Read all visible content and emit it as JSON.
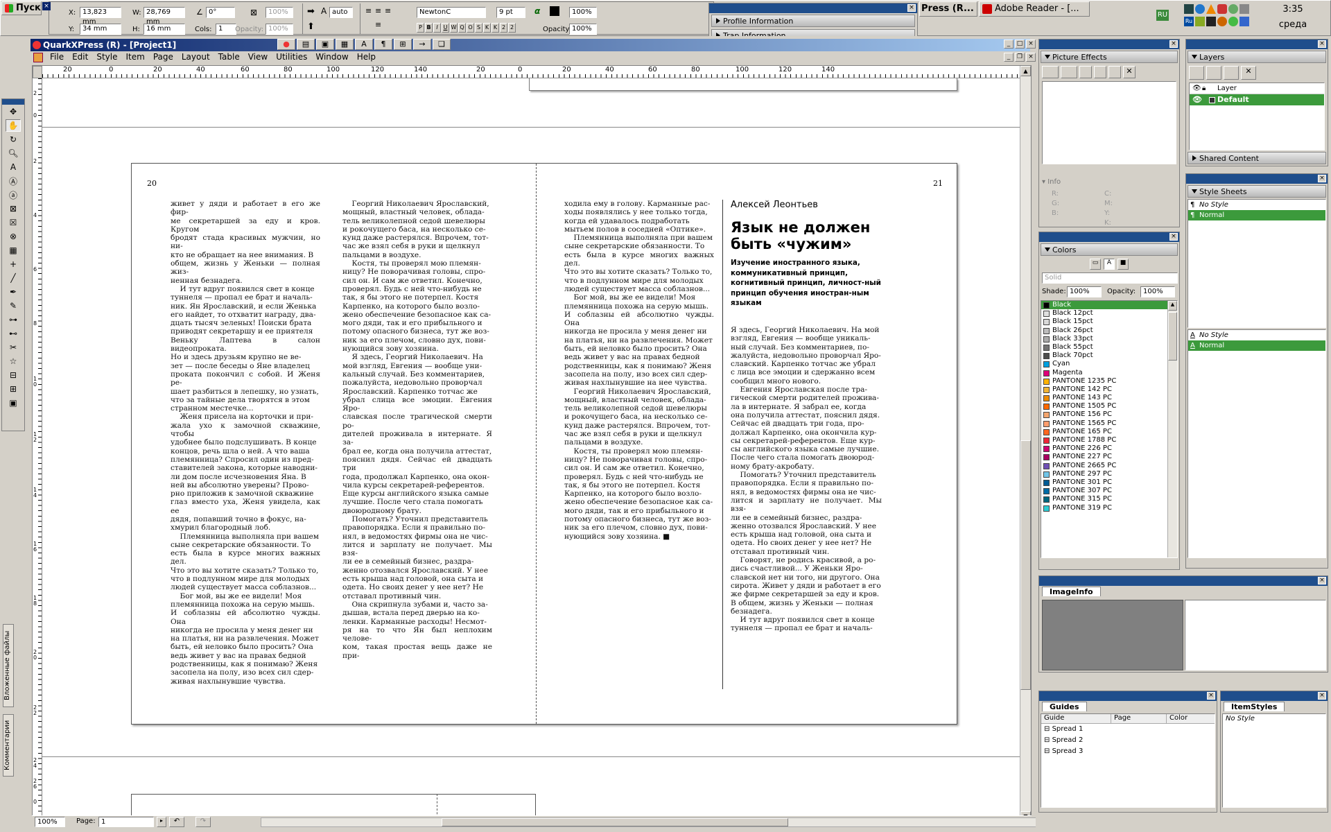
{
  "taskbar": {
    "start_label": "Пуск",
    "tasks": [
      {
        "label": "Press (R..."
      },
      {
        "label": "Adobe Reader - [..."
      }
    ],
    "lang": "RU",
    "time": "3:35",
    "day": "среда"
  },
  "measure": {
    "x_label": "X:",
    "x_value": "13,823 mm",
    "w_label": "W:",
    "w_value": "28,769 mm",
    "y_label": "Y:",
    "y_value": "34 mm",
    "h_label": "H:",
    "h_value": "16 mm",
    "angle": "0°",
    "cols_label": "Cols:",
    "cols_value": "1",
    "opacity_label": "Opacity:",
    "opacity_value": "100%",
    "opacity2_value": "100%",
    "leading": "auto",
    "font": "NewtonC",
    "size": "9 pt",
    "shade": "100%",
    "opacity3_label": "Opacity:",
    "opacity3_value": "100%",
    "style_buttons": [
      "P",
      "B",
      "I",
      "U",
      "W",
      "Q",
      "O",
      "S",
      "K",
      "K",
      "2",
      "2"
    ]
  },
  "floating_palette": {
    "items": [
      {
        "label": "Profile Information"
      },
      {
        "label": "Trap Information"
      }
    ]
  },
  "app": {
    "title": "QuarkXPress (R) - [Project1]",
    "menu": [
      "File",
      "Edit",
      "Style",
      "Item",
      "Page",
      "Layout",
      "Table",
      "View",
      "Utilities",
      "Window",
      "Help"
    ]
  },
  "rulers": {
    "h_labels": [
      "20",
      "0",
      "20",
      "40",
      "60",
      "80",
      "100",
      "120",
      "140",
      "20",
      "0",
      "20",
      "40",
      "60",
      "80",
      "100",
      "120",
      "140"
    ],
    "v_labels": [
      "2",
      "0",
      "2",
      "4",
      "6",
      "8",
      "1 0",
      "1 2",
      "1 4",
      "1 6",
      "1 8",
      "2 0",
      "2 2",
      "2 4",
      "2 6",
      "0"
    ]
  },
  "page_left": {
    "number": "20",
    "col1": "живет у дяди и работает в его же фир-\nме секретаршей за еду и кров. Кругом\nбродят стада красивых мужчин, но ни-\nкто не обращает на нее внимания. В\nобщем, жизнь у Женьки — полная жиз-\nненная безнадега.\n    И тут вдруг появился свет в конце\nтуннеля — пропал ее брат и началь-\nник. Ян Ярославский, и если Женька\nего найдет, то отхватит награду, два-\nдцать тысяч зеленых! Поиски брата\nприводят секретаршу и ее приятеля\nВеньку Лаптева в салон видеопроката.\nНо и здесь друзьям крупно не ве-\nзет — после беседы о Яне владелец\nпроката покончил с собой. И Женя ре-\nшает разбиться в лепешку, но узнать,\nчто за тайные дела творятся в этом\nстранном местечке...\n    Женя присела на корточки и при-\nжала ухо к замочной скважине, чтобы\nудобнее было подслушивать. В конце\nконцов, речь шла о ней. А что ваша\nплемянница? Спросил один из пред-\nставителей закона, которые наводни-\nли дом после исчезновения Яна. В\nней вы абсолютно уверены? Прово-\nрно приложив к замочной скважине\nглаз вместо уха, Женя увидела, как ее\nдядя, попавший точно в фокус, на-\nхмурил благородный лоб.\n    Племянница выполняла при вашем\nсыне секретарские обязанности. То\nесть была в курсе многих важных дел.\nЧто это вы хотите сказать? Только то,\nчто в подлунном мире для молодых\nлюдей существует масса соблазнов...\n    Бог мой, вы же ее видели! Моя\nплемянница похожа на серую мышь.\nИ соблазны ей абсолютно чужды. Она\nникогда не просила у меня денег ни\nна платья, ни на развлечения. Может\nбыть, ей неловко было просить? Она\nведь живет у вас на правах бедной\nродственницы, как я понимаю? Женя\nзасопела на полу, изо всех сил сдер-\nживая нахлынувшие чувства.",
    "col2": "    Георгий Николаевич Ярославский,\nмощный, властный человек, облада-\nтель великолепной седой шевелюры\nи рокочущего баса, на несколько се-\nкунд даже растерялся. Впрочем, тот-\nчас же взял себя в руки и щелкнул\nпальцами в воздухе.\n    Костя, ты проверял мою племян-\nницу? Не поворачивая головы, спро-\nсил он. И сам же ответил. Конечно,\nпроверял. Будь с ней что-нибудь не\nтак, я бы этого не потерпел. Костя\nКарпенко, на которого было возло-\nжено обеспечение безопасное как са-\nмого дяди, так и его прибыльного и\nпотому опасного бизнеса, тут же воз-\nник за его плечом, словно дух, пови-\nнующийся зову хозяина.\n    Я здесь, Георгий Николаевич. На\nмой взгляд, Евгения — вообще уни-\nкальный случай. Без комментариев,\nпожалуйста, недовольно проворчал\nЯрославский. Карпенко тотчас же\nубрал слица все эмоции. Евгения Яро-\nславская после трагической смерти ро-\nдителей проживала в интернате. Я за-\nбрал ее, когда она получила аттестат,\nпояснил дядя. Сейчас ей двадцать три\nгода, продолжал Карпенко, она окон-\nчила курсы секретарей-референтов.\nЕще курсы английского языка самые\nлучшие. После чего стала помогать\nдвоюродному брату.\n    Помогать? Уточнил представитель\nправопорядка. Если я правильно по-\nнял, в ведомостях фирмы она не чис-\nлится и зарплату не получает. Мы взя-\nли ее в семейный бизнес, раздра-\nженно отозвался Ярославский. У нее\nесть крыша над головой, она сыта и\nодета. Но своих денег у нее нет? Не\nотставал противный чин.\n    Она скрипнула зубами и, часто за-\nдышав, встала перед дверью на ко-\nленки. Карманные расходы! Несмот-\nря на то что Ян был неплохим челове-\nком, такая простая вещь даже не при-"
  },
  "page_right": {
    "number": "21",
    "col1": "ходила ему в голову. Карманные рас-\nходы появлялись у нее только тогда,\nкогда ей удавалось подработать\nмытьем полов в соседней «Оптике».\n    Племянница выполняла при вашем\nсыне секретарские обязанности. То\nесть была в курсе многих важных дел.\nЧто это вы хотите сказать? Только то,\nчто в подлунном мире для молодых\nлюдей существует масса соблазнов...\n    Бог мой, вы же ее видели! Моя\nплемянница похожа на серую мышь.\nИ соблазны ей абсолютно чужды. Она\nникогда не просила у меня денег ни\nна платья, ни на развлечения. Может\nбыть, ей неловко было просить? Она\nведь живет у вас на правах бедной\nродственницы, как я понимаю? Женя\nзасопела на полу, изо всех сил сдер-\nживая нахлынувшие на нее чувства.\n    Георгий Николаевич Ярославский,\nмощный, властный человек, облада-\nтель великолепной седой шевелюры\nи рокочущего баса, на несколько се-\nкунд даже растерялся. Впрочем, тот-\nчас же взял себя в руки и щелкнул\nпальцами в воздухе.\n    Костя, ты проверял мою племян-\nницу? Не поворачивая головы, спро-\nсил он. И сам же ответил. Конечно,\nпроверял. Будь с ней что-нибудь не\nтак, я бы этого не потерпел. Костя\nКарпенко, на которого было возло-\nжено обеспечение безопасное как са-\nмого дяди, так и его прибыльного и\nпотому опасного бизнеса, тут же воз-\nник за его плечом, словно дух, пови-\nнующийся зову хозяина. ■",
    "author": "Алексей Леонтьев",
    "headline": "Язык не должен быть «чужим»",
    "lead": "Изучение иностранного языка, коммуникативный принцип, когнитивный принцип, личност-ный принцип обучения иностран-ным языкам",
    "col2": "Я здесь, Георгий Николаевич. На мой\nвзгляд, Евгения — вообще уникаль-\nный случай. Без комментариев, по-\nжалуйста, недовольно проворчал Яро-\nславский. Карпенко тотчас же убрал\nс лица все эмоции и сдержанно всем\nсообщил много нового.\n    Евгения Ярославская после тра-\nгической смерти родителей прожива-\nла в интернате. Я забрал ее, когда\nона получила аттестат, пояснил дядя.\nСейчас ей двадцать три года, про-\nдолжал Карпенко, она окончила кур-\nсы секретарей-референтов. Еще кур-\nсы английского языка самые лучшие.\nПосле чего стала помогать двоюрод-\nному брату-акробату.\n    Помогать? Уточнил представитель\nправопорядка. Если я правильно по-\nнял, в ведомостях фирмы она не чис-\nлится и зарплату не получает. Мы взя-\nли ее в семейный бизнес, раздра-\nженно отозвался Ярославский. У нее\nесть крыша над головой, она сыта и\nодета. Но своих денег у нее нет? Не\nотставал противный чин.\n    Говорят, не родись красивой, а ро-\nдись счастливой... У Женьки Яро-\nславской нет ни того, ни другого. Она\nсирота. Живет у дяди и работает в его\nже фирме секретаршей за еду и кров.\nВ общем, жизнь у Женьки — полная\nбезнадега.\n    И тут вдруг появился свет в конце\nтуннеля — пропал ее брат и началь-"
  },
  "status": {
    "zoom": "100%",
    "page_label": "Page:",
    "page_value": "1"
  },
  "side_tabs": [
    "Вложенные файлы",
    "Комментарии"
  ],
  "picture_effects": {
    "title": "Picture Effects"
  },
  "info": {
    "title": "Info",
    "labels": [
      "R:",
      "G:",
      "B:",
      "C:",
      "M:",
      "Y:",
      "K:"
    ]
  },
  "layers": {
    "title": "Layers",
    "col": "Layer",
    "items": [
      {
        "label": "Default"
      }
    ],
    "shared": "Shared Content"
  },
  "style_sheets": {
    "title": "Style Sheets",
    "para": [
      {
        "label": "No Style"
      },
      {
        "label": "Normal"
      }
    ],
    "char": [
      {
        "label": "No Style"
      },
      {
        "label": "Normal"
      }
    ]
  },
  "colors": {
    "title": "Colors",
    "mode": "Solid",
    "shade_label": "Shade:",
    "shade": "100%",
    "opacity_label": "Opacity:",
    "opacity": "100%",
    "items": [
      {
        "name": "Black",
        "hex": "#000000"
      },
      {
        "name": "Black 12pct",
        "hex": "#e0e0e0"
      },
      {
        "name": "Black 15pct",
        "hex": "#d9d9d9"
      },
      {
        "name": "Black 26pct",
        "hex": "#bdbdbd"
      },
      {
        "name": "Black 33pct",
        "hex": "#ababab"
      },
      {
        "name": "Black 55pct",
        "hex": "#737373"
      },
      {
        "name": "Black 70pct",
        "hex": "#4d4d4d"
      },
      {
        "name": "Cyan",
        "hex": "#00a0e0"
      },
      {
        "name": "Magenta",
        "hex": "#e0007a"
      },
      {
        "name": "PANTONE 1235 PC",
        "hex": "#ffb300"
      },
      {
        "name": "PANTONE 142 PC",
        "hex": "#f1b434"
      },
      {
        "name": "PANTONE 143 PC",
        "hex": "#ed8b00"
      },
      {
        "name": "PANTONE 1505 PC",
        "hex": "#ff6900"
      },
      {
        "name": "PANTONE 156 PC",
        "hex": "#f4a56e"
      },
      {
        "name": "PANTONE 1565 PC",
        "hex": "#ff9d6e"
      },
      {
        "name": "PANTONE 165 PC",
        "hex": "#ff6720"
      },
      {
        "name": "PANTONE 1788 PC",
        "hex": "#ee2737"
      },
      {
        "name": "PANTONE 226 PC",
        "hex": "#d0006f"
      },
      {
        "name": "PANTONE 227 PC",
        "hex": "#aa0061"
      },
      {
        "name": "PANTONE 2665 PC",
        "hex": "#6f50b5"
      },
      {
        "name": "PANTONE 297 PC",
        "hex": "#71c5e8"
      },
      {
        "name": "PANTONE 301 PC",
        "hex": "#005b94"
      },
      {
        "name": "PANTONE 307 PC",
        "hex": "#006ba6"
      },
      {
        "name": "PANTONE 315 PC",
        "hex": "#00677f"
      },
      {
        "name": "PANTONE 319 PC",
        "hex": "#2dccd3"
      }
    ]
  },
  "image_info": {
    "tab": "ImageInfo"
  },
  "guides": {
    "tab": "Guides",
    "cols": [
      "Guide",
      "Page",
      "Color"
    ],
    "rows": [
      {
        "label": "Spread 1"
      },
      {
        "label": "Spread 2"
      },
      {
        "label": "Spread 3"
      }
    ]
  },
  "item_styles": {
    "tab": "ItemStyles",
    "items": [
      {
        "label": "No Style"
      }
    ]
  }
}
